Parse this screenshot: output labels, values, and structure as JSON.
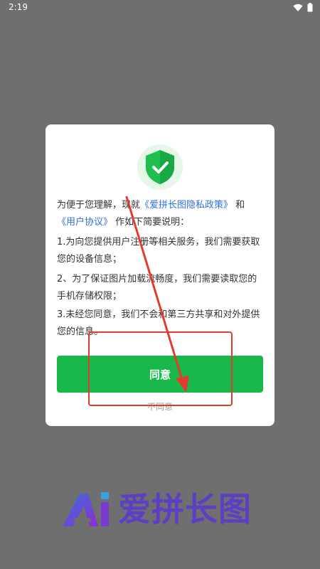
{
  "status_bar": {
    "time": "2:19",
    "icons": [
      "wifi-icon",
      "battery-icon"
    ]
  },
  "dialog": {
    "intro_prefix": "为便于您理解，现就",
    "privacy_link": "《爱拼长图隐私政策》",
    "intro_and": "和",
    "agreement_link": "《用户协议》",
    "intro_suffix": "作如下简要说明：",
    "items": [
      "1.为向您提供用户注册等相关服务，我们需要获取您的设备信息；",
      "2、为了保证图片加载流畅度，我们需要读取您的手机存储权限；",
      "3.未经您同意，我们不会和第三方共享和对外提供您的信息。"
    ],
    "agree_label": "同意",
    "disagree_label": "不同意",
    "icon": "shield-check-icon"
  },
  "brand": {
    "name": "爱拼长图",
    "logo_icon": "brand-ai-logo-icon"
  },
  "colors": {
    "primary_green": "#19b84a",
    "link_blue": "#2f6fe4",
    "annotation_red": "#e33b2e",
    "brand_purple": "#5c3fc3"
  }
}
